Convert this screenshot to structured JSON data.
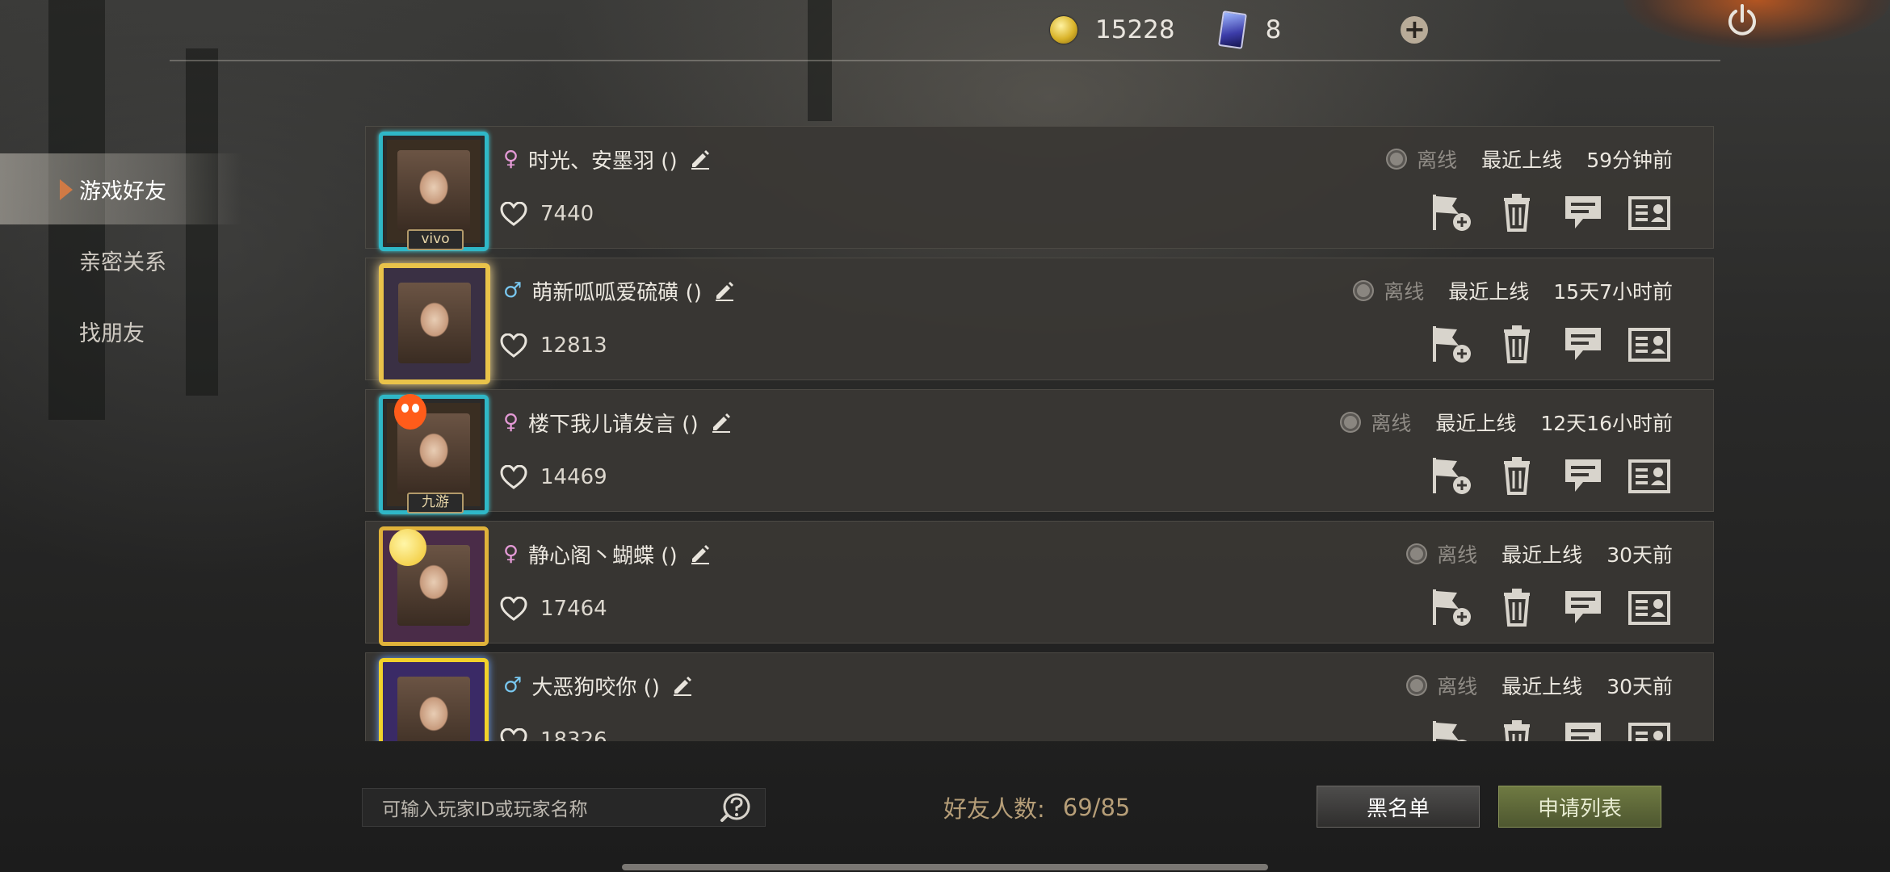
{
  "topbar": {
    "coins": "15228",
    "tickets": "8"
  },
  "sidebar": {
    "items": [
      {
        "label": "游戏好友",
        "active": true
      },
      {
        "label": "亲密关系",
        "active": false
      },
      {
        "label": "找朋友",
        "active": false
      }
    ]
  },
  "friends": [
    {
      "gender": "♀",
      "name": "时光、安墨羽 ()",
      "likes": "7440",
      "status": "离线",
      "last_label": "最近上线",
      "last_time": "59分钟前",
      "frame_tag": "vivo"
    },
    {
      "gender": "♂",
      "name": "萌新呱呱爱硫磺 ()",
      "likes": "12813",
      "status": "离线",
      "last_label": "最近上线",
      "last_time": "15天7小时前",
      "frame_tag": ""
    },
    {
      "gender": "♀",
      "name": "楼下我儿请发言 ()",
      "likes": "14469",
      "status": "离线",
      "last_label": "最近上线",
      "last_time": "12天16小时前",
      "frame_tag": "九游"
    },
    {
      "gender": "♀",
      "name": "静心阁丶蝴蝶 ()",
      "likes": "17464",
      "status": "离线",
      "last_label": "最近上线",
      "last_time": "30天前",
      "frame_tag": ""
    },
    {
      "gender": "♂",
      "name": "大恶狗咬你 ()",
      "likes": "18326",
      "status": "离线",
      "last_label": "最近上线",
      "last_time": "30天前",
      "frame_tag": ""
    }
  ],
  "footer": {
    "search_placeholder": "可输入玩家ID或玩家名称",
    "count_label": "好友人数:",
    "count_value": "69/85",
    "blacklist_label": "黑名单",
    "apply_label": "申请列表"
  },
  "colors": {
    "female": "#e49ad6",
    "male": "#79c7ef",
    "apply_button": "#5e6838",
    "accent": "#d07a45"
  },
  "icons": [
    "coin-icon",
    "ticket-icon",
    "add-icon",
    "power-icon",
    "edit-icon",
    "heart-icon",
    "add-flag-icon",
    "trash-icon",
    "message-icon",
    "profile-card-icon",
    "help-icon"
  ]
}
